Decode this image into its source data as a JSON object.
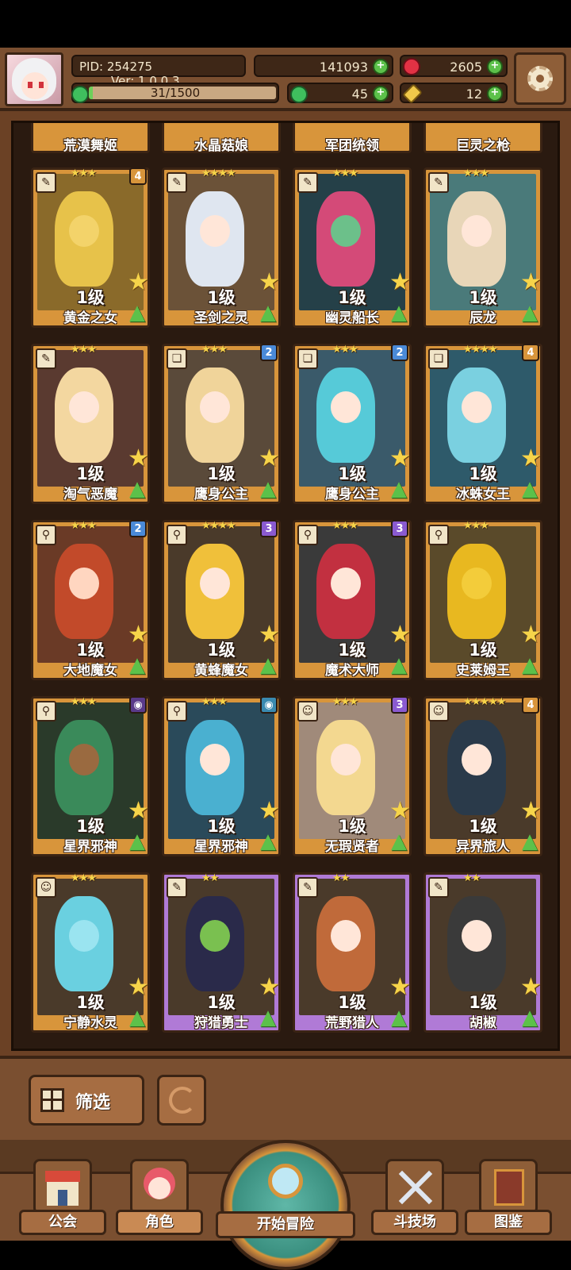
{
  "header": {
    "pid_label": "PID: 254275",
    "version_label": "Ver: 1.0.0.3",
    "gold": "141093",
    "ruby": "2605",
    "xp": "31/1500",
    "clover": "45",
    "keys": "12",
    "xp_progress": 0.0207
  },
  "partial_row": [
    {
      "name": "荒漠舞姬"
    },
    {
      "name": "水晶菇娘"
    },
    {
      "name": "军团统领"
    },
    {
      "name": "巨灵之枪"
    }
  ],
  "cards": [
    {
      "name": "黄金之女",
      "level": "1级",
      "stars": "★★★",
      "badge": "4",
      "badge_color": "#d8953b",
      "type_icon": "wing-icon",
      "art": "#8a6a2a",
      "figure": "#e7c24a",
      "face": "#f3d36a",
      "frame": "gold"
    },
    {
      "name": "圣剑之灵",
      "level": "1级",
      "stars": "★★★★",
      "badge": "",
      "badge_color": "",
      "type_icon": "wing-icon",
      "art": "#6b5238",
      "figure": "#dfe6f0",
      "face": "#ffe6d8",
      "frame": "gold"
    },
    {
      "name": "幽灵船长",
      "level": "1级",
      "stars": "★★★",
      "badge": "",
      "badge_color": "",
      "type_icon": "wing-icon",
      "art": "#254048",
      "figure": "#d44a78",
      "face": "#6cc08a",
      "frame": "gold"
    },
    {
      "name": "辰龙",
      "level": "1级",
      "stars": "★★★",
      "badge": "",
      "badge_color": "",
      "type_icon": "wing-icon",
      "art": "#4a7a7a",
      "figure": "#e8d6b8",
      "face": "#ffe6d8",
      "frame": "gold"
    },
    {
      "name": "淘气恶魔",
      "level": "1级",
      "stars": "★★★",
      "badge": "",
      "badge_color": "",
      "type_icon": "wing-icon",
      "art": "#5a3a30",
      "figure": "#f3d7a0",
      "face": "#ffe6d8",
      "frame": "gold"
    },
    {
      "name": "鹰身公主",
      "level": "1级",
      "stars": "★★★",
      "badge": "2",
      "badge_color": "#4a8ad8",
      "type_icon": "book-icon",
      "art": "#5a4a3a",
      "figure": "#f0d49a",
      "face": "#ffe6d8",
      "frame": "gold"
    },
    {
      "name": "鹰身公主",
      "level": "1级",
      "stars": "★★★",
      "badge": "2",
      "badge_color": "#4a8ad8",
      "type_icon": "book-icon",
      "art": "#3a5a6a",
      "figure": "#56cad8",
      "face": "#ffe6d8",
      "frame": "gold"
    },
    {
      "name": "冰蛛女王",
      "level": "1级",
      "stars": "★★★★",
      "badge": "4",
      "badge_color": "#d8953b",
      "type_icon": "book-icon",
      "art": "#2e5a6a",
      "figure": "#7ad0e0",
      "face": "#ffe6d8",
      "frame": "gold"
    },
    {
      "name": "大地魔女",
      "level": "1级",
      "stars": "★★★",
      "badge": "2",
      "badge_color": "#4a8ad8",
      "type_icon": "staff-icon",
      "art": "#6a3a26",
      "figure": "#c24a2a",
      "face": "#ffd6c0",
      "frame": "gold"
    },
    {
      "name": "黄蜂魔女",
      "level": "1级",
      "stars": "★★★★",
      "badge": "3",
      "badge_color": "#8a5ad0",
      "type_icon": "staff-icon",
      "art": "#4a3a2a",
      "figure": "#f0c03a",
      "face": "#ffe6d8",
      "frame": "gold"
    },
    {
      "name": "魔术大师",
      "level": "1级",
      "stars": "★★★",
      "badge": "3",
      "badge_color": "#8a5ad0",
      "type_icon": "staff-icon",
      "art": "#3a3a3a",
      "figure": "#c23040",
      "face": "#ffe6d8",
      "frame": "gold"
    },
    {
      "name": "史莱姆王",
      "level": "1级",
      "stars": "★★★",
      "badge": "",
      "badge_color": "",
      "type_icon": "staff-icon",
      "art": "#5a4a2a",
      "figure": "#e8b820",
      "face": "#f3cc3a",
      "frame": "gold"
    },
    {
      "name": "星界邪神",
      "level": "1级",
      "stars": "★★★",
      "badge": "◉",
      "badge_color": "#5a3a8a",
      "type_icon": "staff-icon",
      "art": "#2a3a2a",
      "figure": "#3a8a5a",
      "face": "#9a6a40",
      "frame": "gold"
    },
    {
      "name": "星界邪神",
      "level": "1级",
      "stars": "★★★",
      "badge": "◉",
      "badge_color": "#3a8ab0",
      "type_icon": "staff-icon",
      "art": "#2a4a5a",
      "figure": "#4ab0d0",
      "face": "#ffe6d8",
      "frame": "gold"
    },
    {
      "name": "无瑕贤者",
      "level": "1级",
      "stars": "★★★",
      "badge": "3",
      "badge_color": "#8a5ad0",
      "type_icon": "shield-icon",
      "art": "#a08a7a",
      "figure": "#f3d890",
      "face": "#ffe6d8",
      "frame": "gold"
    },
    {
      "name": "异界旅人",
      "level": "1级",
      "stars": "★★★★★",
      "badge": "4",
      "badge_color": "#d8953b",
      "type_icon": "shield-icon",
      "art": "#4a3a2a",
      "figure": "#2a3a4a",
      "face": "#ffe6d8",
      "frame": "gold"
    },
    {
      "name": "宁静水灵",
      "level": "1级",
      "stars": "★★★",
      "badge": "",
      "badge_color": "",
      "type_icon": "shield-icon",
      "art": "#4a3a2a",
      "figure": "#6ad0e0",
      "face": "#9ae4f0",
      "frame": "gold"
    },
    {
      "name": "狩猎勇士",
      "level": "1级",
      "stars": "★★",
      "badge": "",
      "badge_color": "",
      "type_icon": "wing-icon",
      "art": "#4a3a2a",
      "figure": "#2a2a4a",
      "face": "#7ac050",
      "frame": "purple"
    },
    {
      "name": "荒野猎人",
      "level": "1级",
      "stars": "★★",
      "badge": "",
      "badge_color": "",
      "type_icon": "wing-icon",
      "art": "#4a3a2a",
      "figure": "#c06a3a",
      "face": "#ffe6d8",
      "frame": "purple"
    },
    {
      "name": "胡椒",
      "level": "1级",
      "stars": "★★",
      "badge": "",
      "badge_color": "",
      "type_icon": "wing-icon",
      "art": "#4a3a2a",
      "figure": "#3a3a3a",
      "face": "#ffe6d8",
      "frame": "purple"
    }
  ],
  "filter": {
    "label": "筛选"
  },
  "nav": {
    "guild": "公会",
    "character": "角色",
    "adventure": "开始冒险",
    "arena": "斗技场",
    "codex": "图鉴"
  }
}
